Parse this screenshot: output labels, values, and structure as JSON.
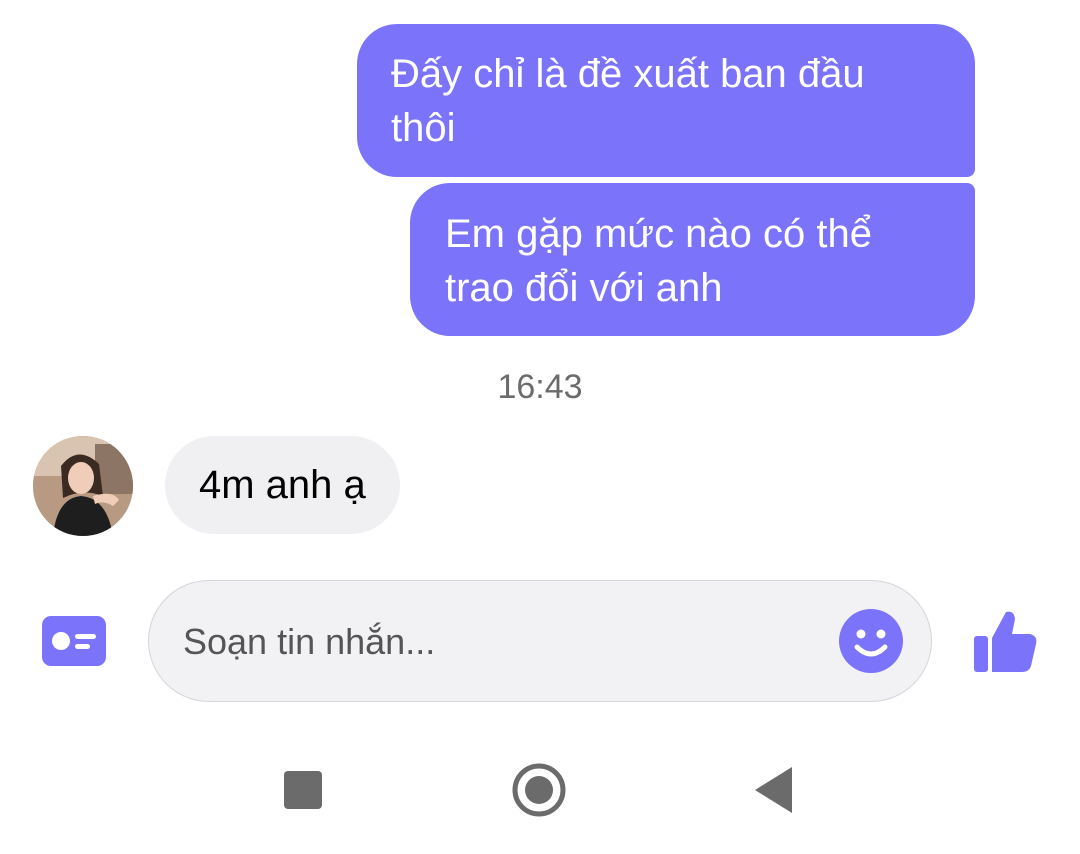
{
  "theme": {
    "accent": "#7b74fb",
    "incoming_bubble": "#f0f0f2",
    "nav_icon": "#6b6b6b"
  },
  "messages": {
    "outgoing": [
      {
        "text": "Đấy chỉ là đề xuất ban đầu\nthôi"
      },
      {
        "text": "Em gặp mức nào có thể\ntrao đổi với anh"
      }
    ],
    "timestamp": "16:43",
    "incoming": [
      {
        "text": "4m anh ạ",
        "sender_avatar": "avatar-photo"
      }
    ]
  },
  "composer": {
    "placeholder": "Soạn tin nhắn...",
    "value": "",
    "left_icon": "contact-card-icon",
    "emoji_icon": "smiley-icon",
    "send_icon": "thumbs-up-icon"
  },
  "navbar": {
    "recent_icon": "square-icon",
    "home_icon": "circle-icon",
    "back_icon": "triangle-back-icon"
  }
}
